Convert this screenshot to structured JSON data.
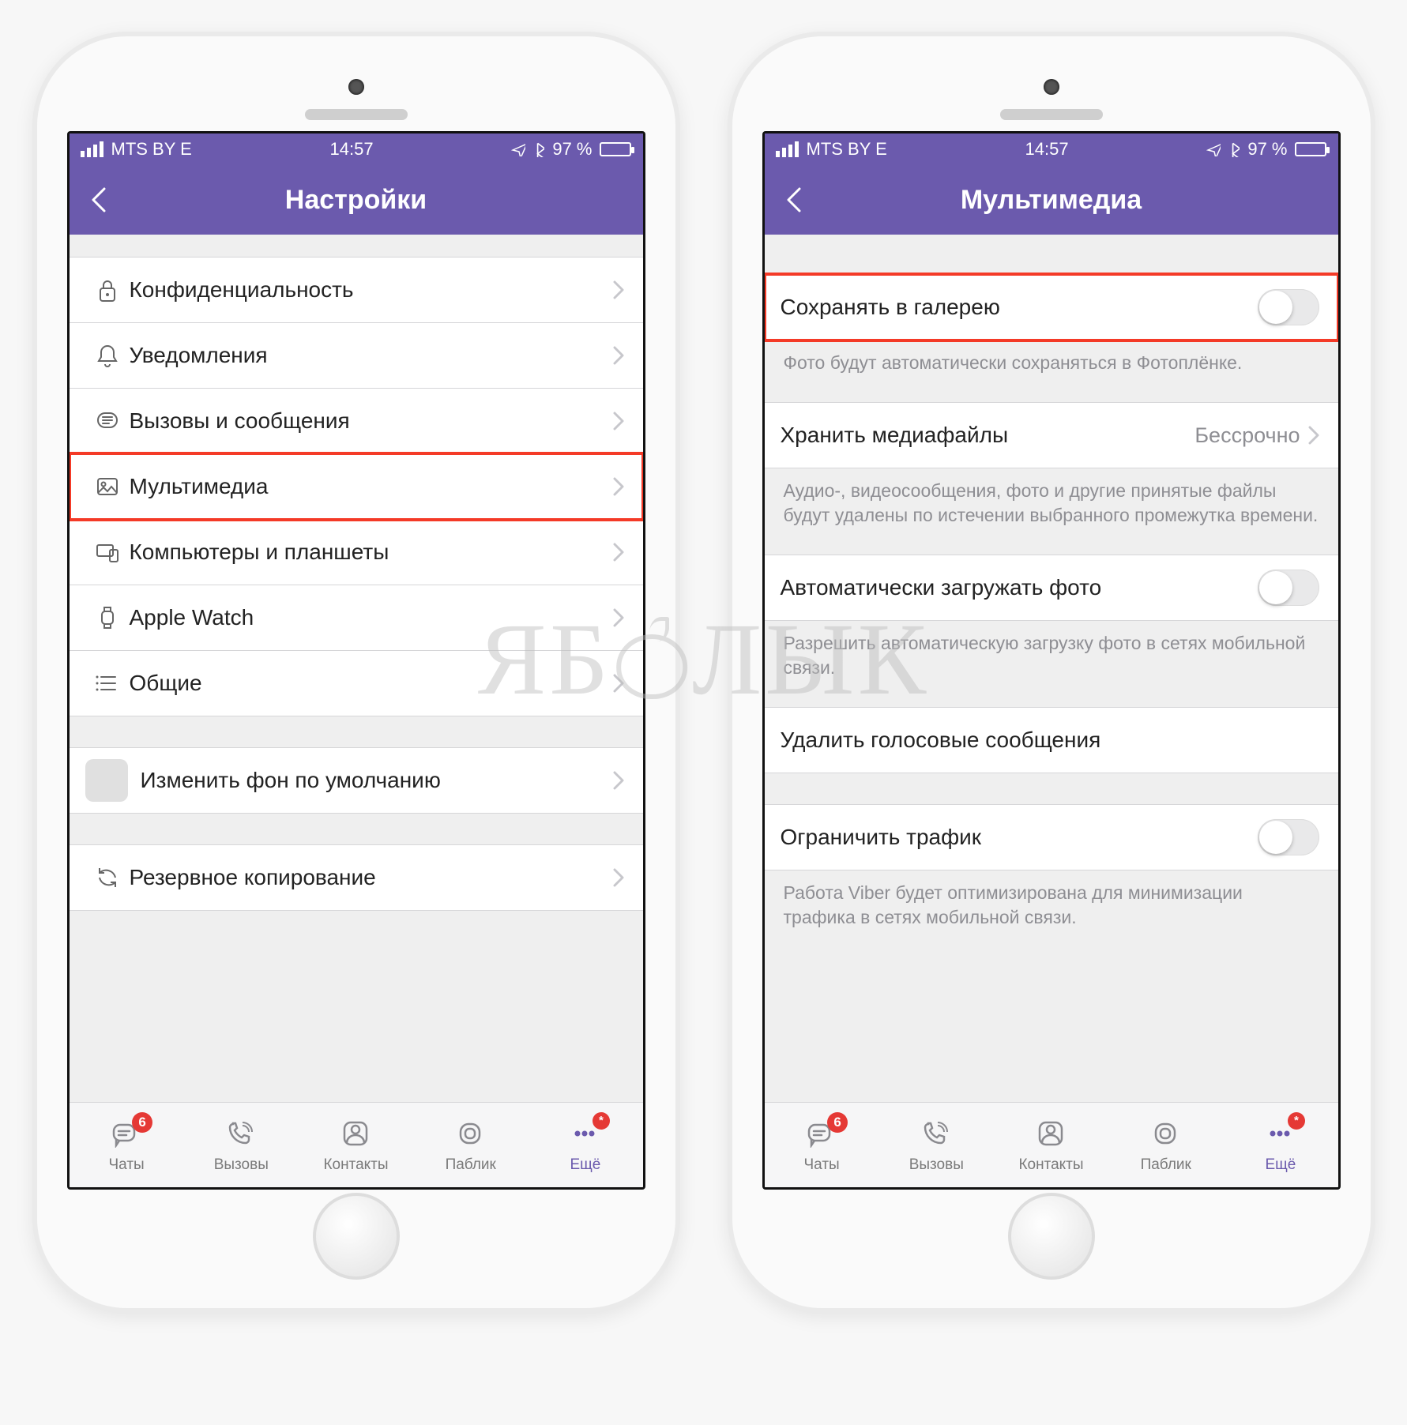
{
  "status": {
    "carrier": "MTS BY  E",
    "time": "14:57",
    "battery_pct": "97 %"
  },
  "left": {
    "title": "Настройки",
    "items": [
      {
        "label": "Конфиденциальность",
        "icon": "lock-icon"
      },
      {
        "label": "Уведомления",
        "icon": "bell-icon"
      },
      {
        "label": "Вызовы и сообщения",
        "icon": "message-icon"
      },
      {
        "label": "Мультимедиа",
        "icon": "photo-icon",
        "highlight": true
      },
      {
        "label": "Компьютеры и планшеты",
        "icon": "devices-icon"
      },
      {
        "label": "Apple Watch",
        "icon": "watch-icon"
      },
      {
        "label": "Общие",
        "icon": "list-icon"
      }
    ],
    "wallpaper_label": "Изменить фон по умолчанию",
    "backup_label": "Резервное копирование"
  },
  "right": {
    "title": "Мультимедиа",
    "save_gallery": {
      "label": "Сохранять в галерею",
      "note": "Фото будут автоматически сохраняться в Фотоплёнке."
    },
    "keep_media": {
      "label": "Хранить медиафайлы",
      "value": "Бессрочно",
      "note": "Аудио-, видеосообщения, фото и другие принятые файлы будут удалены по истечении выбранного промежутка времени."
    },
    "auto_dl": {
      "label": "Автоматически загружать фото",
      "note": "Разрешить автоматическую загрузку фото в сетях мобильной связи."
    },
    "del_voice": {
      "label": "Удалить голосовые сообщения"
    },
    "limit_traffic": {
      "label": "Ограничить трафик",
      "note": "Работа Viber будет оптимизирована для минимизации трафика в сетях мобильной связи."
    }
  },
  "tabs": {
    "chats": {
      "label": "Чаты",
      "badge": "6"
    },
    "calls": {
      "label": "Вызовы"
    },
    "contacts": {
      "label": "Контакты"
    },
    "public": {
      "label": "Паблик"
    },
    "more": {
      "label": "Ещё",
      "badge": "*"
    }
  },
  "watermark": "ЯБ ЛЫК"
}
